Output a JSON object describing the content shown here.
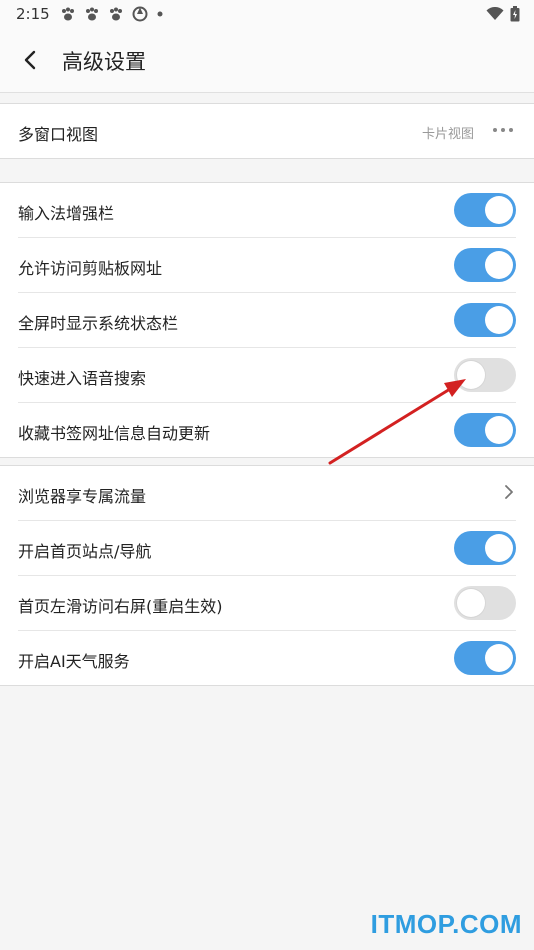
{
  "status_bar": {
    "time": "2:15"
  },
  "header": {
    "title": "高级设置"
  },
  "section1": {
    "multi_window": {
      "label": "多窗口视图",
      "value": "卡片视图"
    }
  },
  "section2": {
    "items": [
      {
        "label": "输入法增强栏",
        "enabled": true
      },
      {
        "label": "允许访问剪贴板网址",
        "enabled": true
      },
      {
        "label": "全屏时显示系统状态栏",
        "enabled": true
      },
      {
        "label": "快速进入语音搜索",
        "enabled": false
      },
      {
        "label": "收藏书签网址信息自动更新",
        "enabled": true
      }
    ]
  },
  "section3": {
    "traffic": {
      "label": "浏览器享专属流量"
    },
    "items": [
      {
        "label": "开启首页站点/导航",
        "enabled": true
      },
      {
        "label": "首页左滑访问右屏(重启生效)",
        "enabled": false
      },
      {
        "label": "开启AI天气服务",
        "enabled": true
      }
    ]
  },
  "colors": {
    "accent": "#4a9ee6",
    "toggle_off": "#e0e0e0",
    "arrow": "#d32121",
    "watermark": "#2f9de0"
  },
  "watermark": "ITMOP.COM"
}
